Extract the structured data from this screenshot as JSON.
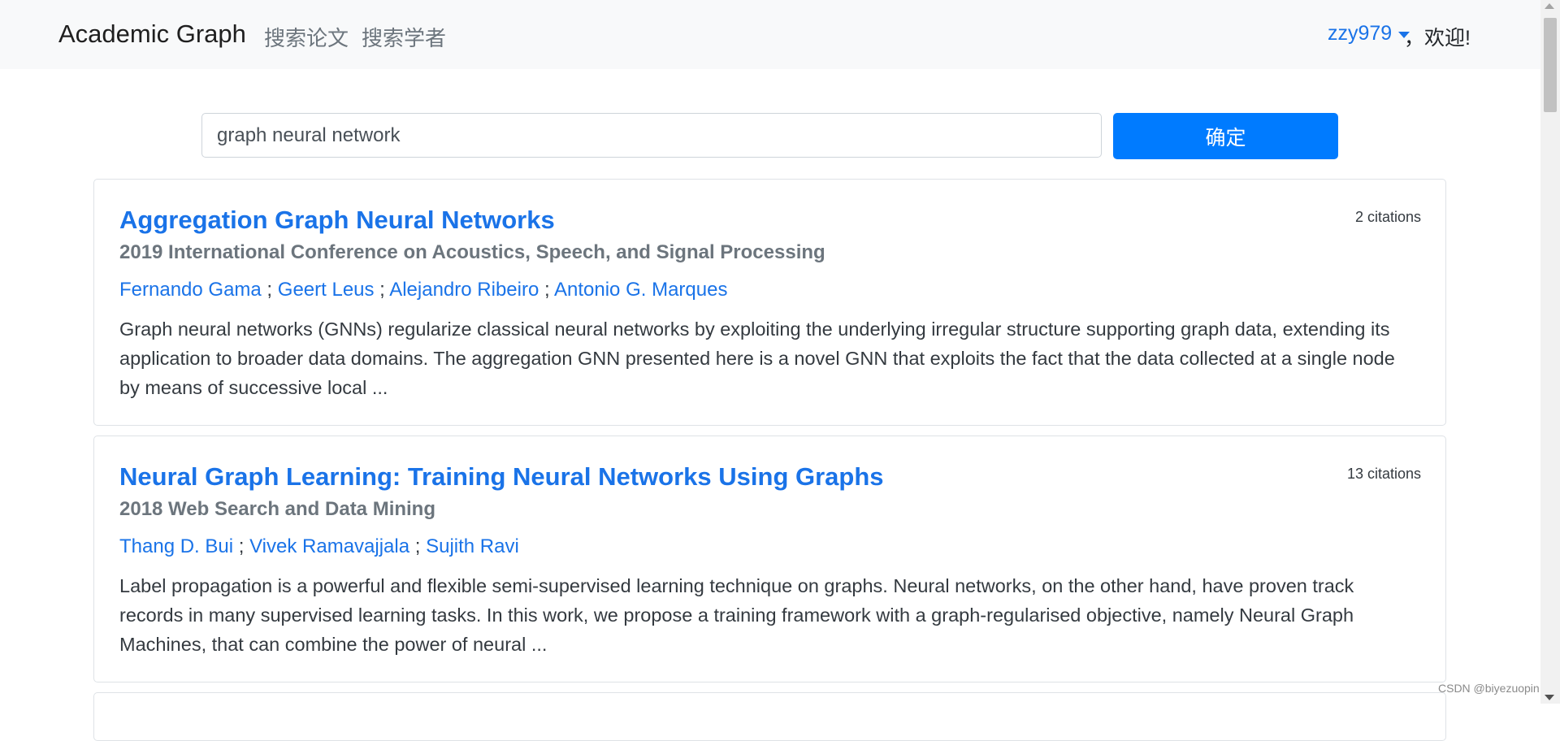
{
  "navbar": {
    "brand": "Academic Graph",
    "links": [
      "搜索论文",
      "搜索学者"
    ],
    "username": "zzy979",
    "welcome": "，欢迎!"
  },
  "search": {
    "query": "graph neural network",
    "button_label": "确定"
  },
  "results": [
    {
      "title": "Aggregation Graph Neural Networks",
      "citations": "2 citations",
      "venue": "2019 International Conference on Acoustics, Speech, and Signal Processing",
      "authors": [
        "Fernando Gama",
        "Geert Leus",
        "Alejandro Ribeiro",
        "Antonio G. Marques"
      ],
      "separator": " ; ",
      "abstract": "Graph neural networks (GNNs) regularize classical neural networks by exploiting the underlying irregular structure supporting graph data, extending its application to broader data domains. The aggregation GNN presented here is a novel GNN that exploits the fact that the data collected at a single node by means of successive local ..."
    },
    {
      "title": "Neural Graph Learning: Training Neural Networks Using Graphs",
      "citations": "13 citations",
      "venue": "2018 Web Search and Data Mining",
      "authors": [
        "Thang D. Bui",
        "Vivek Ramavajjala",
        "Sujith Ravi"
      ],
      "separator": " ; ",
      "abstract": "Label propagation is a powerful and flexible semi-supervised learning technique on graphs. Neural networks, on the other hand, have proven track records in many supervised learning tasks. In this work, we propose a training framework with a graph-regularised objective, namely Neural Graph Machines, that can combine the power of neural ..."
    }
  ],
  "watermark": "CSDN @biyezuopin",
  "colors": {
    "accent": "#1a73e8",
    "button": "#007bff",
    "navbar_bg": "#f8f9fa",
    "muted": "#6c757d"
  }
}
